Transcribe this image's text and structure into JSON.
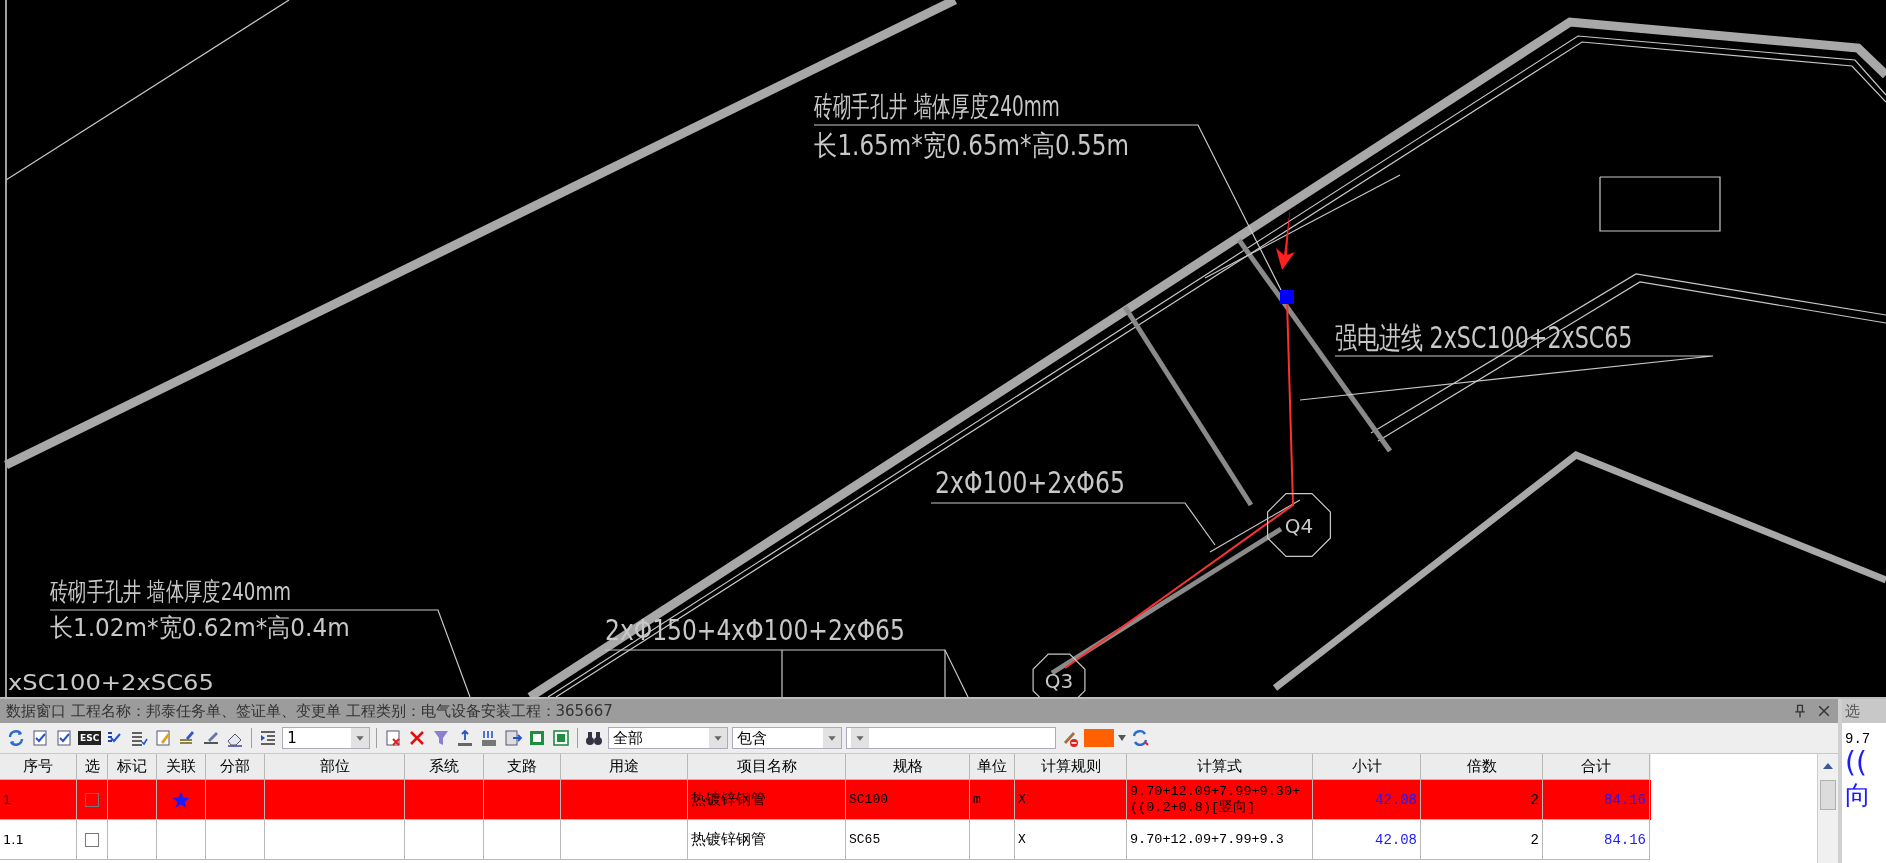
{
  "drawing": {
    "annotations": [
      {
        "text": "砖砌手孔井  墙体厚度240mm"
      },
      {
        "text": "长1.65m*宽0.65m*高0.55m"
      },
      {
        "text": "强电进线  2xSC100+2xSC65"
      },
      {
        "text": "2xΦ100+2xΦ65"
      },
      {
        "text": "砖砌手孔井  墙体厚度240mm"
      },
      {
        "text": "长1.02m*宽0.62m*高0.4m"
      },
      {
        "text": "2xΦ150+4xΦ100+2xΦ65"
      },
      {
        "text": "xSC100+2xSC65"
      }
    ],
    "nodes": [
      {
        "label": "Q4"
      },
      {
        "label": "Q3"
      }
    ]
  },
  "data_window": {
    "title": "数据窗口 工程名称：邦泰任务单、签证单、变更单 工程类别：电气设备安装工程：365667",
    "toolbar": {
      "esc_key": "ESC",
      "level_value": "1",
      "scope_value": "全部",
      "match_value": "包含"
    },
    "columns": [
      "序号",
      "选",
      "标记",
      "关联",
      "分部",
      "部位",
      "系统",
      "支路",
      "用途",
      "项目名称",
      "规格",
      "单位",
      "计算规则",
      "计算式",
      "小计",
      "倍数",
      "合计"
    ],
    "rows": [
      {
        "selected": true,
        "checked": false,
        "linked": true,
        "seq": "1",
        "item_name": "热镀锌钢管",
        "spec": "SC100",
        "unit": "m",
        "rule": "X",
        "formula": "9.70+12.09+7.99+9.30+((0.2+0.8)[竖向]",
        "subtotal": "42.08",
        "multiplier": "2",
        "total": "84.16"
      },
      {
        "selected": false,
        "checked": false,
        "linked": false,
        "seq": "1.1",
        "item_name": "热镀锌钢管",
        "spec": "SC65",
        "rule": "X",
        "formula": "9.70+12.09+7.99+9.3",
        "subtotal": "42.08",
        "multiplier": "2",
        "total": "84.16"
      }
    ]
  },
  "side_panel": {
    "title": "选",
    "lines": [
      "9.7",
      "((",
      "向"
    ]
  }
}
